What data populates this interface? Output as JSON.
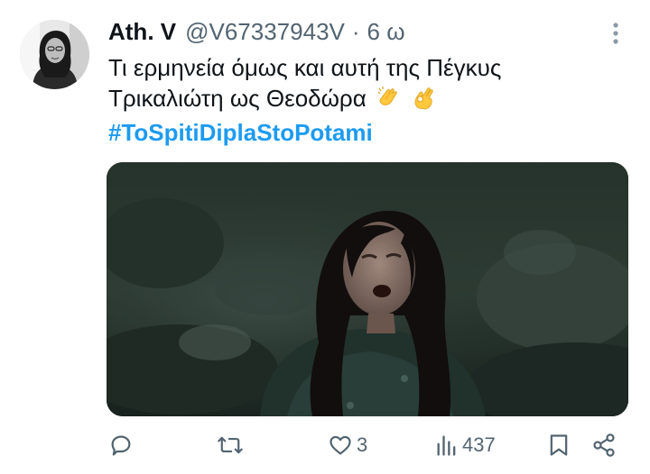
{
  "tweet": {
    "author_name": "Ath. V",
    "handle": "@V67337943V",
    "separator": "·",
    "time": "6 ω",
    "text_line1": "Τι ερμηνεία όμως και αυτή της Πέγκυς",
    "text_line2": "Τρικαλιώτη ως Θεοδώρα",
    "emojis": [
      "clapping-hands",
      "ok-hand"
    ],
    "hashtag": "#ToSpitiDiplaStoPotami"
  },
  "actions": {
    "reply_count": "",
    "retweet_count": "",
    "like_count": "3",
    "views_count": "437"
  },
  "icons": {
    "more": "more-vertical-icon",
    "reply": "reply-icon",
    "retweet": "retweet-icon",
    "like": "heart-icon",
    "views": "views-icon",
    "bookmark": "bookmark-icon",
    "share": "share-icon"
  },
  "colors": {
    "text": "#0f1419",
    "secondary": "#536471",
    "link": "#1d9bf0"
  }
}
